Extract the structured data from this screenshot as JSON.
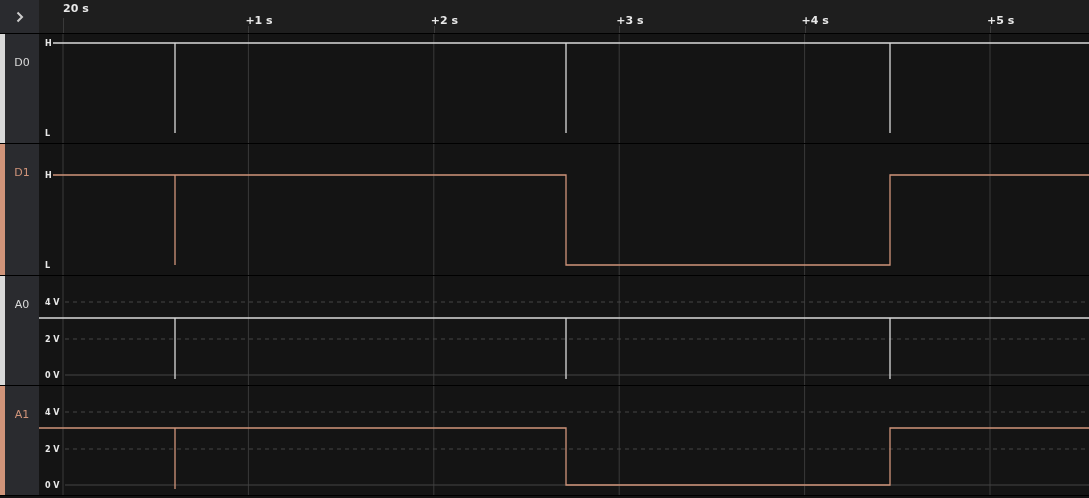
{
  "timeline": {
    "labels": [
      "20 s",
      "+1 s",
      "+2 s",
      "+3 s",
      "+4 s",
      "+5 s"
    ]
  },
  "channels": [
    {
      "name": "D0",
      "kind": "logic",
      "color": "#d9d9d9",
      "axis_labels": [
        "H",
        "L"
      ]
    },
    {
      "name": "D1",
      "kind": "logic",
      "color": "#d0947a",
      "axis_labels": [
        "H",
        "L"
      ]
    },
    {
      "name": "A0",
      "kind": "analog",
      "color": "#d9d9d9",
      "axis_labels": [
        "4 V",
        "2 V",
        "0 V"
      ]
    },
    {
      "name": "A1",
      "kind": "analog",
      "color": "#d0947a",
      "axis_labels": [
        "4 V",
        "2 V",
        "0 V"
      ]
    }
  ]
}
